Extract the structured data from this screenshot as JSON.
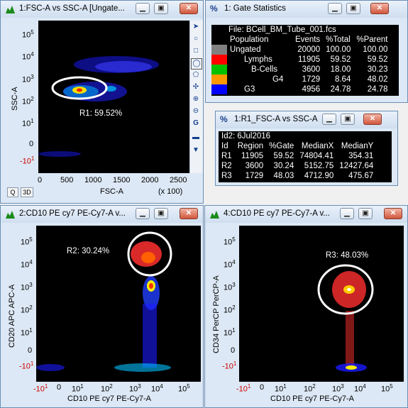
{
  "windows": {
    "w1": {
      "title": "1:FSC-A vs SSC-A [Ungate...",
      "xlabel": "FSC-A",
      "ylabel": "SSC-A",
      "xscale_note": "(x 100)",
      "xticks": [
        "0",
        "500",
        "1000",
        "1500",
        "2000",
        "2500"
      ],
      "yticks": [
        "10^5",
        "10^4",
        "10^3",
        "10^2",
        "10^1",
        "0",
        "-10^1"
      ],
      "gate_label": "R1: 59.52%"
    },
    "w_stats": {
      "title": "1: Gate Statistics"
    },
    "w_region": {
      "title": "1:R1_FSC-A vs SSC-A"
    },
    "w2": {
      "title": "2:CD10 PE cy7 PE-Cy7-A v...",
      "xlabel": "CD10 PE cy7 PE-Cy7-A",
      "ylabel": "CD20 APC APC-A",
      "gate_label": "R2: 30.24%"
    },
    "w4": {
      "title": "4:CD10 PE cy7 PE-Cy7-A v...",
      "xlabel": "CD10 PE cy7 PE-Cy7-A",
      "ylabel": "CD34 PerCP PerCP-A",
      "gate_label": "R3: 48.03%"
    },
    "log_xticks": [
      "-10^1",
      "0",
      "10^1",
      "10^2",
      "10^3",
      "10^4",
      "10^5"
    ]
  },
  "buttons": {
    "q": "Q",
    "three_d": "3D"
  },
  "gate_stats": {
    "file_line": "File: BCell_BM_Tube_001.fcs",
    "headers": [
      "Population",
      "Events",
      "%Total",
      "%Parent"
    ],
    "rows": [
      {
        "name": "Ungated",
        "events": "20000",
        "total": "100.00",
        "parent": "100.00",
        "color": "#808080"
      },
      {
        "name": "Lymphs",
        "events": "11905",
        "total": "59.52",
        "parent": "59.52",
        "color": "#ff0000"
      },
      {
        "name": "B-Cells",
        "events": "3600",
        "total": "18.00",
        "parent": "30.23",
        "color": "#00c000"
      },
      {
        "name": "G4",
        "events": "1729",
        "total": "8.64",
        "parent": "48.02",
        "color": "#ff9900"
      },
      {
        "name": "G3",
        "events": "4956",
        "total": "24.78",
        "parent": "24.78",
        "color": "#0000ff"
      }
    ]
  },
  "region_stats": {
    "id_line": "Id2: 6Jul2016",
    "headers": [
      "Id",
      "Region",
      "%Gate",
      "MedianX",
      "MedianY"
    ],
    "rows": [
      [
        "R1",
        "11905",
        "59.52",
        "74804.41",
        "354.31"
      ],
      [
        "R2",
        "3600",
        "30.24",
        "5152.75",
        "12427.64"
      ],
      [
        "R3",
        "1729",
        "48.03",
        "4712.90",
        "475.67"
      ]
    ]
  },
  "tools": [
    "pointer",
    "circle",
    "square",
    "ellipse",
    "polygon",
    "crosshair",
    "zoom-in",
    "zoom-out",
    "gate-g1",
    "minus",
    "chevron-down"
  ],
  "colors": {
    "titlebar": "#dce8f5",
    "plot_bg": "#000000",
    "gate": "#ffffff"
  }
}
